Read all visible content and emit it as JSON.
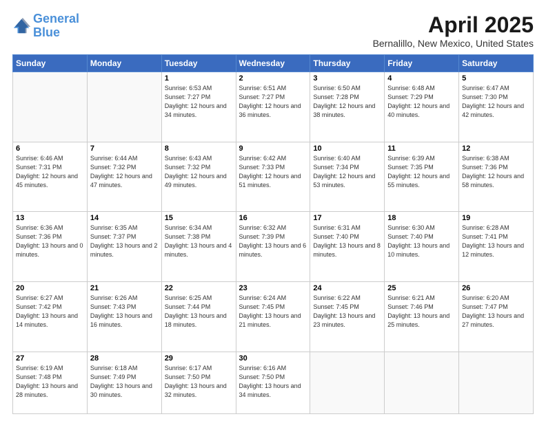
{
  "header": {
    "logo_line1": "General",
    "logo_line2": "Blue",
    "title": "April 2025",
    "subtitle": "Bernalillo, New Mexico, United States"
  },
  "days_of_week": [
    "Sunday",
    "Monday",
    "Tuesday",
    "Wednesday",
    "Thursday",
    "Friday",
    "Saturday"
  ],
  "weeks": [
    [
      {
        "day": "",
        "info": ""
      },
      {
        "day": "",
        "info": ""
      },
      {
        "day": "1",
        "info": "Sunrise: 6:53 AM\nSunset: 7:27 PM\nDaylight: 12 hours and 34 minutes."
      },
      {
        "day": "2",
        "info": "Sunrise: 6:51 AM\nSunset: 7:27 PM\nDaylight: 12 hours and 36 minutes."
      },
      {
        "day": "3",
        "info": "Sunrise: 6:50 AM\nSunset: 7:28 PM\nDaylight: 12 hours and 38 minutes."
      },
      {
        "day": "4",
        "info": "Sunrise: 6:48 AM\nSunset: 7:29 PM\nDaylight: 12 hours and 40 minutes."
      },
      {
        "day": "5",
        "info": "Sunrise: 6:47 AM\nSunset: 7:30 PM\nDaylight: 12 hours and 42 minutes."
      }
    ],
    [
      {
        "day": "6",
        "info": "Sunrise: 6:46 AM\nSunset: 7:31 PM\nDaylight: 12 hours and 45 minutes."
      },
      {
        "day": "7",
        "info": "Sunrise: 6:44 AM\nSunset: 7:32 PM\nDaylight: 12 hours and 47 minutes."
      },
      {
        "day": "8",
        "info": "Sunrise: 6:43 AM\nSunset: 7:32 PM\nDaylight: 12 hours and 49 minutes."
      },
      {
        "day": "9",
        "info": "Sunrise: 6:42 AM\nSunset: 7:33 PM\nDaylight: 12 hours and 51 minutes."
      },
      {
        "day": "10",
        "info": "Sunrise: 6:40 AM\nSunset: 7:34 PM\nDaylight: 12 hours and 53 minutes."
      },
      {
        "day": "11",
        "info": "Sunrise: 6:39 AM\nSunset: 7:35 PM\nDaylight: 12 hours and 55 minutes."
      },
      {
        "day": "12",
        "info": "Sunrise: 6:38 AM\nSunset: 7:36 PM\nDaylight: 12 hours and 58 minutes."
      }
    ],
    [
      {
        "day": "13",
        "info": "Sunrise: 6:36 AM\nSunset: 7:36 PM\nDaylight: 13 hours and 0 minutes."
      },
      {
        "day": "14",
        "info": "Sunrise: 6:35 AM\nSunset: 7:37 PM\nDaylight: 13 hours and 2 minutes."
      },
      {
        "day": "15",
        "info": "Sunrise: 6:34 AM\nSunset: 7:38 PM\nDaylight: 13 hours and 4 minutes."
      },
      {
        "day": "16",
        "info": "Sunrise: 6:32 AM\nSunset: 7:39 PM\nDaylight: 13 hours and 6 minutes."
      },
      {
        "day": "17",
        "info": "Sunrise: 6:31 AM\nSunset: 7:40 PM\nDaylight: 13 hours and 8 minutes."
      },
      {
        "day": "18",
        "info": "Sunrise: 6:30 AM\nSunset: 7:40 PM\nDaylight: 13 hours and 10 minutes."
      },
      {
        "day": "19",
        "info": "Sunrise: 6:28 AM\nSunset: 7:41 PM\nDaylight: 13 hours and 12 minutes."
      }
    ],
    [
      {
        "day": "20",
        "info": "Sunrise: 6:27 AM\nSunset: 7:42 PM\nDaylight: 13 hours and 14 minutes."
      },
      {
        "day": "21",
        "info": "Sunrise: 6:26 AM\nSunset: 7:43 PM\nDaylight: 13 hours and 16 minutes."
      },
      {
        "day": "22",
        "info": "Sunrise: 6:25 AM\nSunset: 7:44 PM\nDaylight: 13 hours and 18 minutes."
      },
      {
        "day": "23",
        "info": "Sunrise: 6:24 AM\nSunset: 7:45 PM\nDaylight: 13 hours and 21 minutes."
      },
      {
        "day": "24",
        "info": "Sunrise: 6:22 AM\nSunset: 7:45 PM\nDaylight: 13 hours and 23 minutes."
      },
      {
        "day": "25",
        "info": "Sunrise: 6:21 AM\nSunset: 7:46 PM\nDaylight: 13 hours and 25 minutes."
      },
      {
        "day": "26",
        "info": "Sunrise: 6:20 AM\nSunset: 7:47 PM\nDaylight: 13 hours and 27 minutes."
      }
    ],
    [
      {
        "day": "27",
        "info": "Sunrise: 6:19 AM\nSunset: 7:48 PM\nDaylight: 13 hours and 28 minutes."
      },
      {
        "day": "28",
        "info": "Sunrise: 6:18 AM\nSunset: 7:49 PM\nDaylight: 13 hours and 30 minutes."
      },
      {
        "day": "29",
        "info": "Sunrise: 6:17 AM\nSunset: 7:50 PM\nDaylight: 13 hours and 32 minutes."
      },
      {
        "day": "30",
        "info": "Sunrise: 6:16 AM\nSunset: 7:50 PM\nDaylight: 13 hours and 34 minutes."
      },
      {
        "day": "",
        "info": ""
      },
      {
        "day": "",
        "info": ""
      },
      {
        "day": "",
        "info": ""
      }
    ]
  ]
}
